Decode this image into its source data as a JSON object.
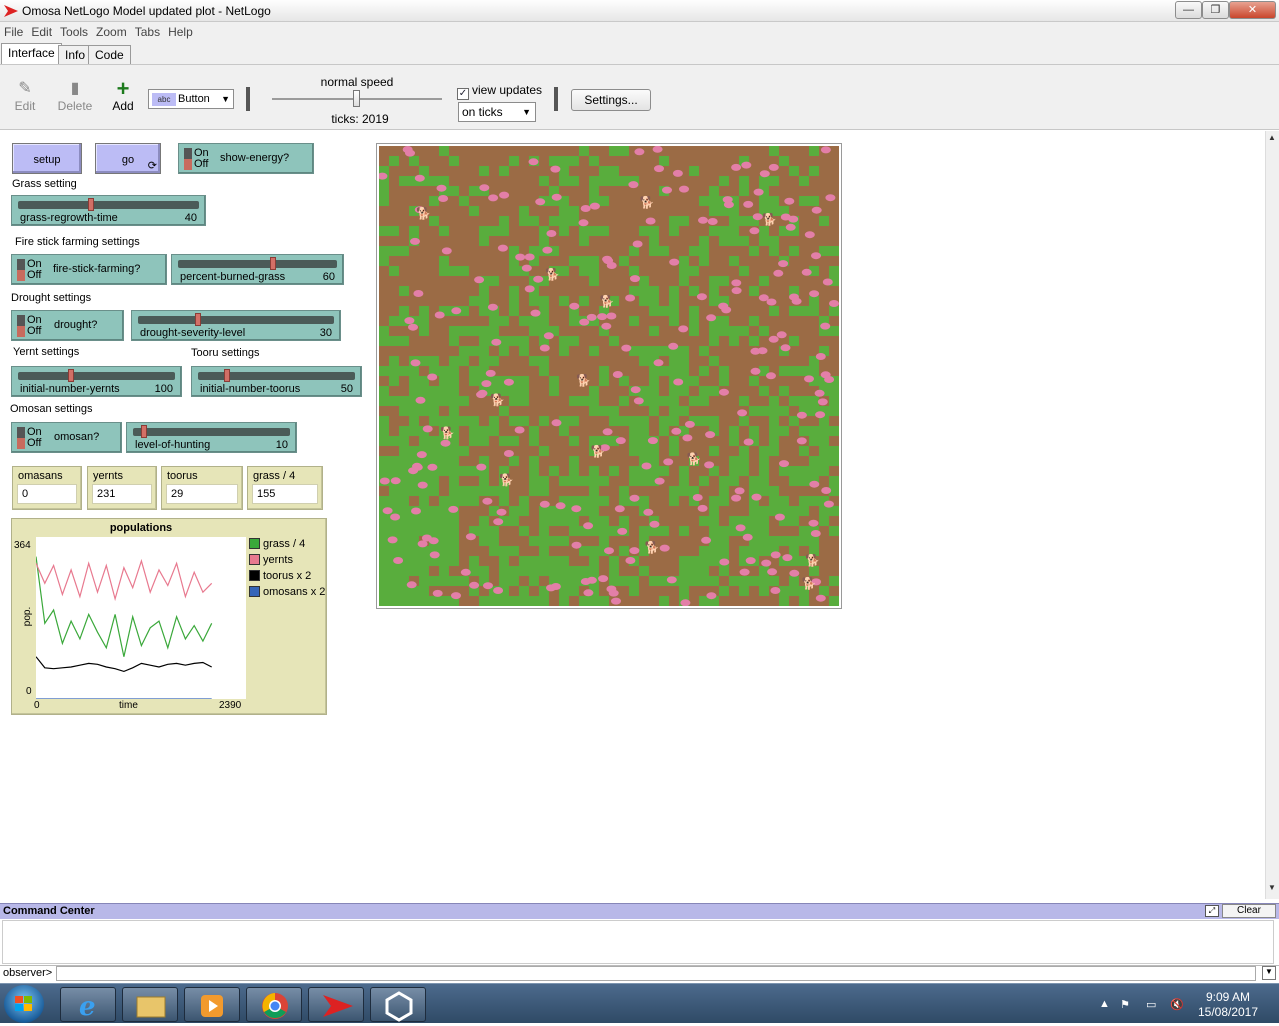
{
  "window": {
    "title": "Omosa NetLogo Model updated plot - NetLogo",
    "min": "—",
    "max": "❐",
    "close": "✕"
  },
  "menu": [
    "File",
    "Edit",
    "Tools",
    "Zoom",
    "Tabs",
    "Help"
  ],
  "tabs": [
    "Interface",
    "Info",
    "Code"
  ],
  "toolbar": {
    "edit": "Edit",
    "delete": "Delete",
    "add": "Add",
    "widget_type": "Button",
    "speed_label": "normal speed",
    "speed_fraction": 0.5,
    "ticks": "ticks: 2019",
    "view_updates": "view updates",
    "view_updates_checked": true,
    "update_mode": "on ticks",
    "settings": "Settings..."
  },
  "widgets": {
    "setup": "setup",
    "go": "go",
    "switch_on": "On",
    "switch_off": "Off",
    "show_energy": "show-energy?",
    "grass_setting": "Grass setting",
    "grass_regrowth": {
      "name": "grass-regrowth-time",
      "value": "40",
      "fraction": 0.4
    },
    "fire_setting": "Fire stick farming settings",
    "fire_switch": "fire-stick-farming?",
    "burned": {
      "name": "percent-burned-grass",
      "value": "60",
      "fraction": 0.6
    },
    "drought_setting": "Drought settings",
    "drought_switch": "drought?",
    "severity": {
      "name": "drought-severity-level",
      "value": "30",
      "fraction": 0.3
    },
    "yernt_setting": "Yernt settings",
    "tooru_setting": "Tooru settings",
    "yernts_init": {
      "name": "initial-number-yernts",
      "value": "100",
      "fraction": 0.33
    },
    "toorus_init": {
      "name": "initial-number-toorus",
      "value": "50",
      "fraction": 0.17
    },
    "omosan_setting": "Omosan settings",
    "omosan_switch": "omosan?",
    "hunting": {
      "name": "level-of-hunting",
      "value": "10",
      "fraction": 0.05
    }
  },
  "monitors": [
    {
      "name": "omasans",
      "value": "0"
    },
    {
      "name": "yernts",
      "value": "231"
    },
    {
      "name": "toorus",
      "value": "29"
    },
    {
      "name": "grass / 4",
      "value": "155"
    }
  ],
  "plot": {
    "title": "populations",
    "ylabel": "pop.",
    "xlabel": "time",
    "ymax_label": "364",
    "ymin_label": "0",
    "xmin_label": "0",
    "xmax_label": "2390"
  },
  "chart_data": {
    "type": "line",
    "title": "populations",
    "xlabel": "time",
    "ylabel": "pop.",
    "xlim": [
      0,
      2390
    ],
    "ylim": [
      0,
      364
    ],
    "x": [
      0,
      100,
      200,
      300,
      400,
      500,
      600,
      700,
      800,
      900,
      1000,
      1100,
      1200,
      1300,
      1400,
      1500,
      1600,
      1700,
      1800,
      1900,
      2000
    ],
    "series": [
      {
        "name": "grass / 4",
        "color": "#3aa83a",
        "values": [
          320,
          170,
          200,
          125,
          175,
          135,
          190,
          150,
          115,
          190,
          95,
          185,
          120,
          160,
          175,
          115,
          185,
          135,
          165,
          130,
          170
        ]
      },
      {
        "name": "yernts",
        "color": "#e8798f",
        "values": [
          305,
          260,
          300,
          235,
          290,
          230,
          305,
          240,
          300,
          225,
          295,
          250,
          310,
          240,
          290,
          255,
          305,
          230,
          285,
          240,
          260
        ]
      },
      {
        "name": "toorus x 2",
        "color": "#000000",
        "values": [
          95,
          70,
          68,
          70,
          72,
          76,
          80,
          78,
          72,
          68,
          62,
          70,
          80,
          76,
          72,
          78,
          80,
          76,
          80,
          82,
          72
        ]
      },
      {
        "name": "omosans x 2",
        "color": "#3565b8",
        "values": [
          0,
          0,
          0,
          0,
          0,
          0,
          0,
          0,
          0,
          0,
          0,
          0,
          0,
          0,
          0,
          0,
          0,
          0,
          0,
          0,
          0
        ]
      }
    ]
  },
  "world": {
    "dirt_color": "#9b6b45",
    "grass_color": "#59ad3d",
    "yernt_color": "#e37fa8",
    "tooru_color": "#111111"
  },
  "command_center": {
    "title": "Command Center",
    "clear": "Clear",
    "prompt": "observer>"
  },
  "taskbar": {
    "time": "9:09 AM",
    "date": "15/08/2017"
  }
}
